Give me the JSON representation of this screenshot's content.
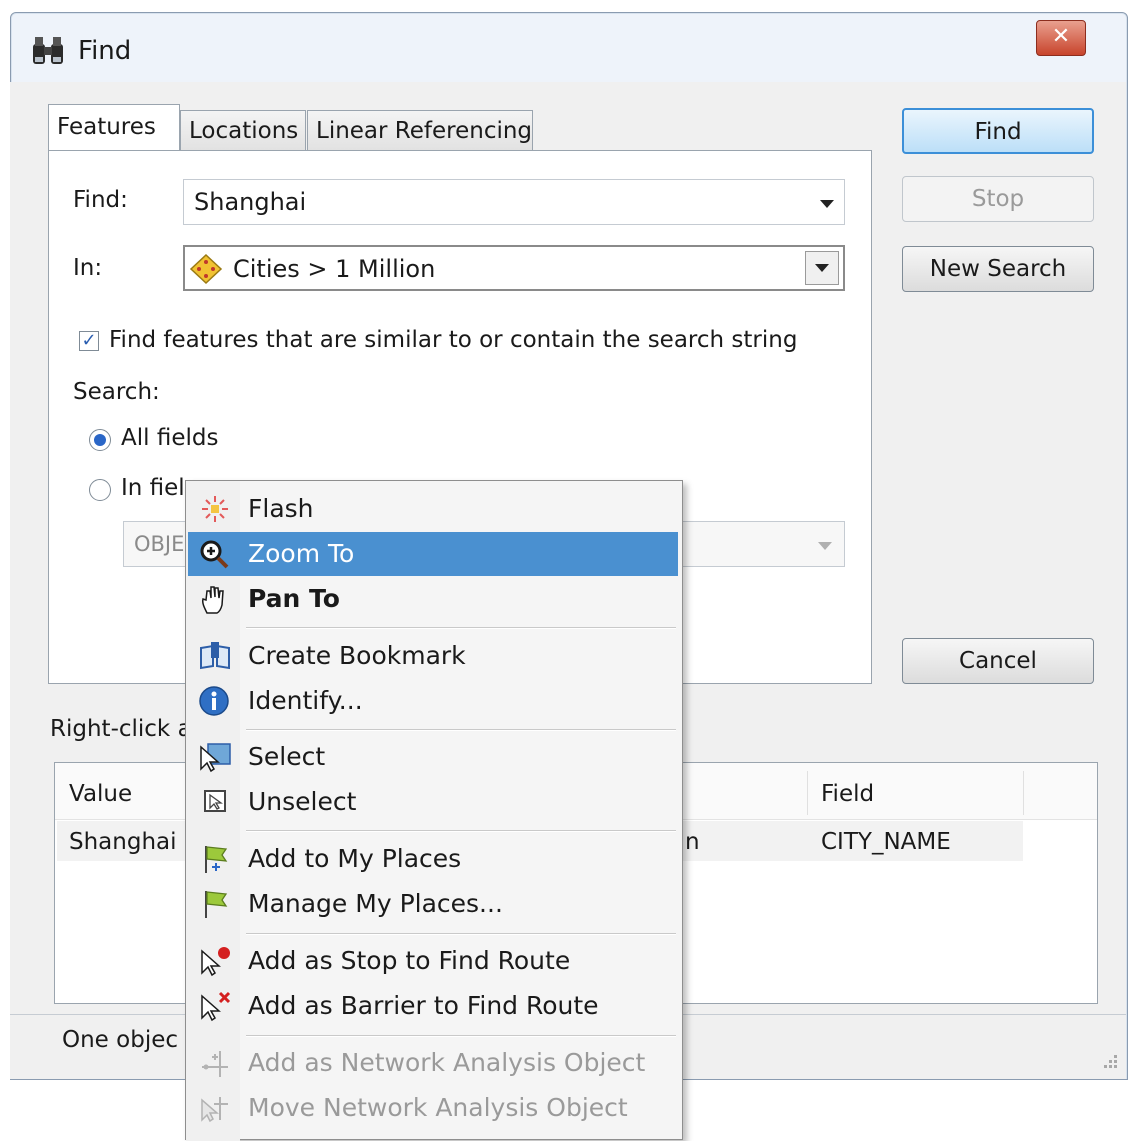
{
  "window": {
    "title": "Find",
    "close_label": "✕"
  },
  "tabs": [
    {
      "label": "Features",
      "active": true
    },
    {
      "label": "Locations",
      "active": false
    },
    {
      "label": "Linear Referencing",
      "active": false
    }
  ],
  "form": {
    "find_label": "Find:",
    "find_value": "Shanghai",
    "in_label": "In:",
    "in_value": "Cities > 1 Million",
    "similar_checkbox_label": "Find features that are similar to or contain the search string",
    "similar_checked": true,
    "search_label": "Search:",
    "all_fields_label": "All fields",
    "in_field_label": "In fiel",
    "field_select_value": "OBJE"
  },
  "buttons": {
    "find": "Find",
    "stop": "Stop",
    "new_search": "New Search",
    "cancel": "Cancel"
  },
  "results": {
    "hint": "Right-click a",
    "columns": [
      "Value",
      "Field"
    ],
    "rows": [
      {
        "value": "Shanghai",
        "partial": "n",
        "field": "CITY_NAME"
      }
    ]
  },
  "status": {
    "text": "One objec"
  },
  "context_menu": {
    "items": [
      {
        "label": "Flash",
        "icon": "flash-icon"
      },
      {
        "label": "Zoom To",
        "icon": "zoom-in-icon",
        "highlighted": true
      },
      {
        "label": "Pan To",
        "icon": "hand-icon",
        "bold": true
      },
      {
        "label": "Create Bookmark",
        "icon": "bookmark-icon"
      },
      {
        "label": "Identify...",
        "icon": "info-icon"
      },
      {
        "label": "Select",
        "icon": "select-icon"
      },
      {
        "label": "Unselect",
        "icon": "unselect-icon"
      },
      {
        "label": "Add to My Places",
        "icon": "flag-add-icon"
      },
      {
        "label": "Manage My Places...",
        "icon": "flag-icon"
      },
      {
        "label": "Add as Stop to Find Route",
        "icon": "route-stop-icon"
      },
      {
        "label": "Add as Barrier to Find Route",
        "icon": "route-barrier-icon"
      },
      {
        "label": "Add as Network Analysis Object",
        "icon": "network-add-icon",
        "disabled": true
      },
      {
        "label": "Move Network Analysis Object",
        "icon": "network-move-icon",
        "disabled": true
      }
    ]
  },
  "colors": {
    "highlight": "#4a90d0",
    "primary_button_border": "#3c8fd8"
  }
}
